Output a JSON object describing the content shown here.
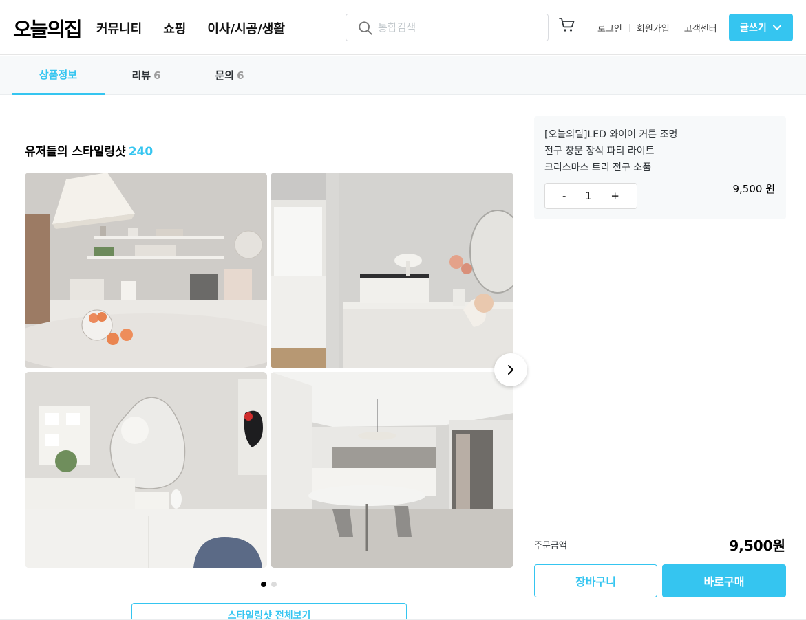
{
  "header": {
    "logo": "오늘의집",
    "nav": [
      "커뮤니티",
      "쇼핑",
      "이사/시공/생활"
    ],
    "search_placeholder": "통합검색",
    "user_links": [
      "로그인",
      "회원가입",
      "고객센터"
    ],
    "write_label": "글쓰기"
  },
  "tabs": [
    {
      "label": "상품정보",
      "count": ""
    },
    {
      "label": "리뷰",
      "count": "6"
    },
    {
      "label": "문의",
      "count": "6"
    }
  ],
  "styling": {
    "title": "유저들의 스타일링샷",
    "count": "240",
    "view_all": "스타일링샷 전체보기",
    "pagination": {
      "total": 2,
      "current": 1
    }
  },
  "option": {
    "name_lines": [
      "[오늘의딜]LED 와이어 커튼 조명",
      "전구 창문 장식 파티 라이트",
      "크리스마스 트리 전구 소품"
    ],
    "minus": "-",
    "quantity": "1",
    "plus": "+",
    "price": "9,500 원"
  },
  "order": {
    "label": "주문금액",
    "total": "9,500원",
    "cart_label": "장바구니",
    "buy_label": "바로구매"
  },
  "colors": {
    "accent": "#35c5f0"
  }
}
